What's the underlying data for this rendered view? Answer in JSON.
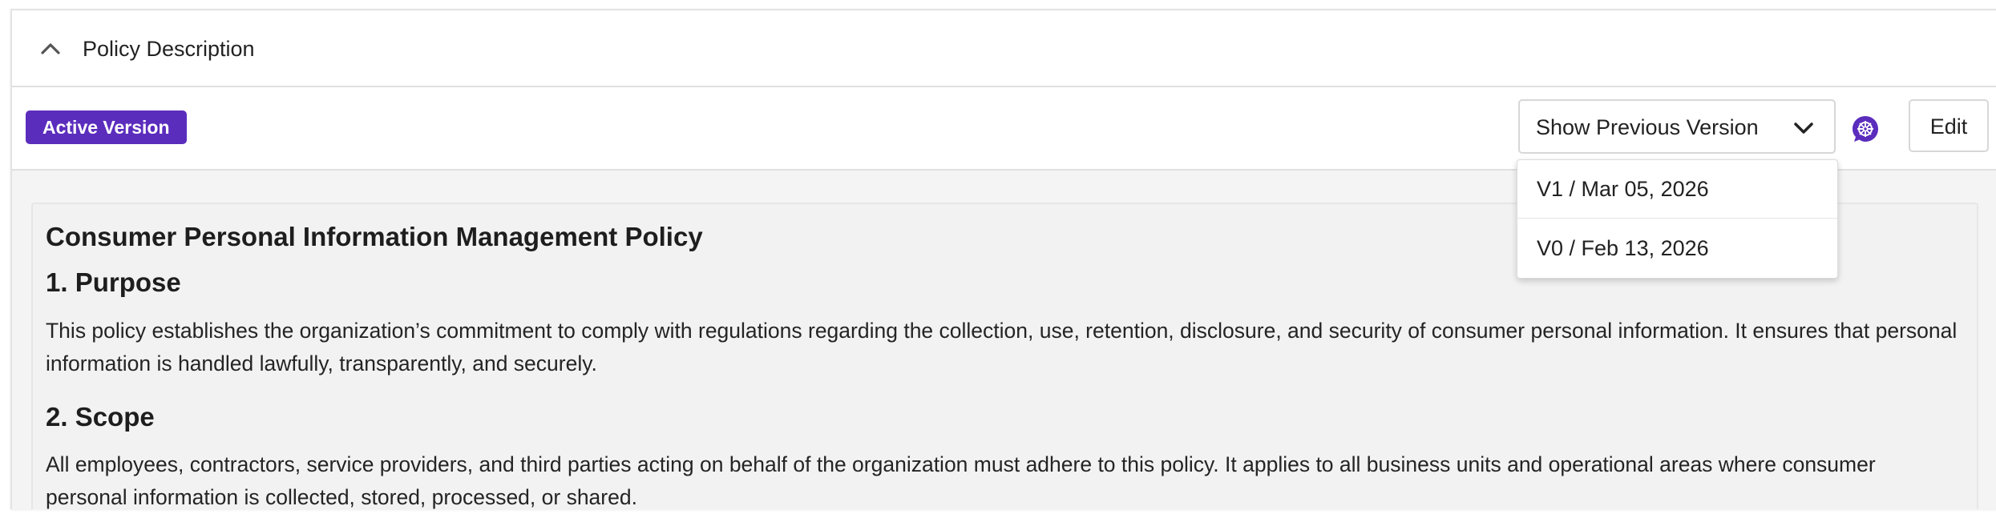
{
  "header": {
    "title": "Policy Description"
  },
  "toolbar": {
    "badge_label": "Active Version",
    "version_select_label": "Show Previous Version",
    "edit_label": "Edit",
    "badge_color": "#5b2dbd"
  },
  "version_dropdown": {
    "options": [
      {
        "label": "V1 / Mar 05, 2026"
      },
      {
        "label": "V0 / Feb 13, 2026"
      }
    ]
  },
  "document": {
    "title": "Consumer Personal Information Management Policy",
    "sections": [
      {
        "heading": "1. Purpose",
        "body": "This policy establishes the organization’s commitment to comply with regulations regarding the collection, use, retention, disclosure, and security of consumer personal information. It ensures that personal information is handled lawfully, transparently, and securely."
      },
      {
        "heading": "2. Scope",
        "body": "All employees, contractors, service providers, and third parties acting on behalf of the organization must adhere to this policy. It applies to all business units and operational areas where consumer personal information is collected, stored, processed, or shared."
      }
    ]
  },
  "icons": {
    "collapse": "chevron-up-icon",
    "dropdown": "chevron-down-icon",
    "ai": "ai-assistant-icon"
  }
}
